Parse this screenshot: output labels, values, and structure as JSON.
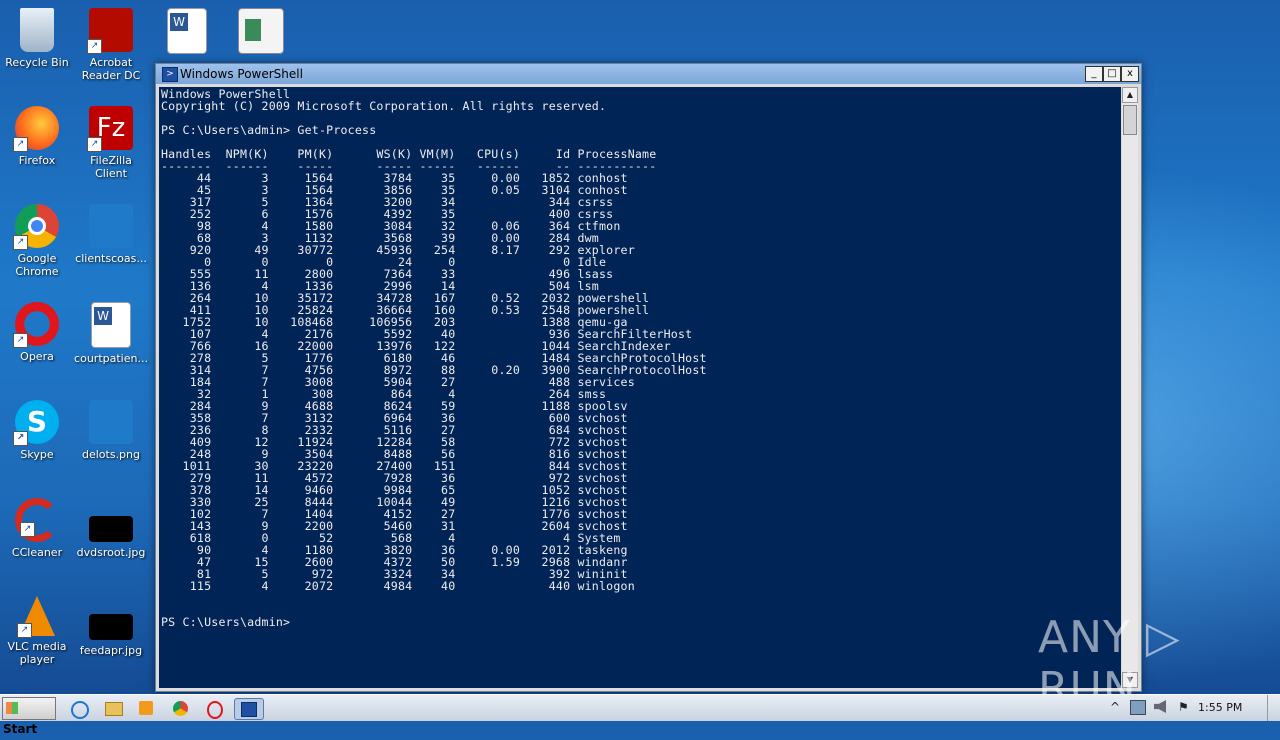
{
  "desktop": {
    "icons": [
      {
        "label": "Recycle Bin",
        "icon": "recycle-bin-icon"
      },
      {
        "label": "Acrobat Reader DC",
        "icon": "acrobat-icon"
      },
      {
        "label": "",
        "icon": "word-doc-icon"
      },
      {
        "label": "",
        "icon": "image-file-icon"
      },
      {
        "label": "Firefox",
        "icon": "firefox-icon"
      },
      {
        "label": "FileZilla Client",
        "icon": "filezilla-icon"
      },
      {
        "label": "Google Chrome",
        "icon": "chrome-icon"
      },
      {
        "label": "clientscoas...",
        "icon": "blank-file-icon"
      },
      {
        "label": "Opera",
        "icon": "opera-icon"
      },
      {
        "label": "courtpatien...",
        "icon": "word-doc-icon"
      },
      {
        "label": "Skype",
        "icon": "skype-icon"
      },
      {
        "label": "delots.png",
        "icon": "blank-file-icon"
      },
      {
        "label": "CCleaner",
        "icon": "ccleaner-icon"
      },
      {
        "label": "dvdsroot.jpg",
        "icon": "black-image-icon"
      },
      {
        "label": "VLC media player",
        "icon": "vlc-icon"
      },
      {
        "label": "feedapr.jpg",
        "icon": "black-image-icon"
      }
    ]
  },
  "window": {
    "title": "Windows PowerShell",
    "min_btn": "_",
    "max_btn": "□",
    "close_btn": "x"
  },
  "console": {
    "text": "Windows PowerShell\nCopyright (C) 2009 Microsoft Corporation. All rights reserved.\n\nPS C:\\Users\\admin> Get-Process\n\nHandles  NPM(K)    PM(K)      WS(K) VM(M)   CPU(s)     Id ProcessName\n-------  ------    -----      ----- -----   ------     -- -----------\n     44       3     1564       3784    35     0.00   1852 conhost\n     45       3     1564       3856    35     0.05   3104 conhost\n    317       5     1364       3200    34             344 csrss\n    252       6     1576       4392    35             400 csrss\n     98       4     1580       3084    32     0.06    364 ctfmon\n     68       3     1132       3568    39     0.00    284 dwm\n    920      49    30772      45936   254     8.17    292 explorer\n      0       0        0         24     0               0 Idle\n    555      11     2800       7364    33             496 lsass\n    136       4     1336       2996    14             504 lsm\n    264      10    35172      34728   167     0.52   2032 powershell\n    411      10    25824      36664   160     0.53   2548 powershell\n   1752      10   108468     106956   203            1388 qemu-ga\n    107       4     2176       5592    40             936 SearchFilterHost\n    766      16    22000      13976   122            1044 SearchIndexer\n    278       5     1776       6180    46            1484 SearchProtocolHost\n    314       7     4756       8972    88     0.20   3900 SearchProtocolHost\n    184       7     3008       5904    27             488 services\n     32       1      308        864     4             264 smss\n    284       9     4688       8624    59            1188 spoolsv\n    358       7     3132       6964    36             600 svchost\n    236       8     2332       5116    27             684 svchost\n    409      12    11924      12284    58             772 svchost\n    248       9     3504       8488    56             816 svchost\n   1011      30    23220      27400   151             844 svchost\n    279      11     4572       7928    36             972 svchost\n    378      14     9460       9984    65            1052 svchost\n    330      25     8444      10044    49            1216 svchost\n    102       7     1404       4152    27            1776 svchost\n    143       9     2200       5460    31            2604 svchost\n    618       0       52        568     4               4 System\n     90       4     1180       3820    36     0.00   2012 taskeng\n     47      15     2600       4372    50     1.59   2968 windanr\n     81       5      972       3324    34             392 wininit\n    115       4     2072       4984    40             440 winlogon\n\n\nPS C:\\Users\\admin>"
  },
  "scrollbar": {
    "up": "▲",
    "down": "▼"
  },
  "watermark": "ANY ▷ RUN",
  "taskbar": {
    "start_label": "Start",
    "apps": [
      "ie-icon",
      "explorer-icon",
      "media-player-icon",
      "chrome-icon",
      "opera-icon",
      "powershell-icon"
    ],
    "tray": [
      "^",
      "⚑"
    ],
    "clock": "1:55 PM"
  }
}
